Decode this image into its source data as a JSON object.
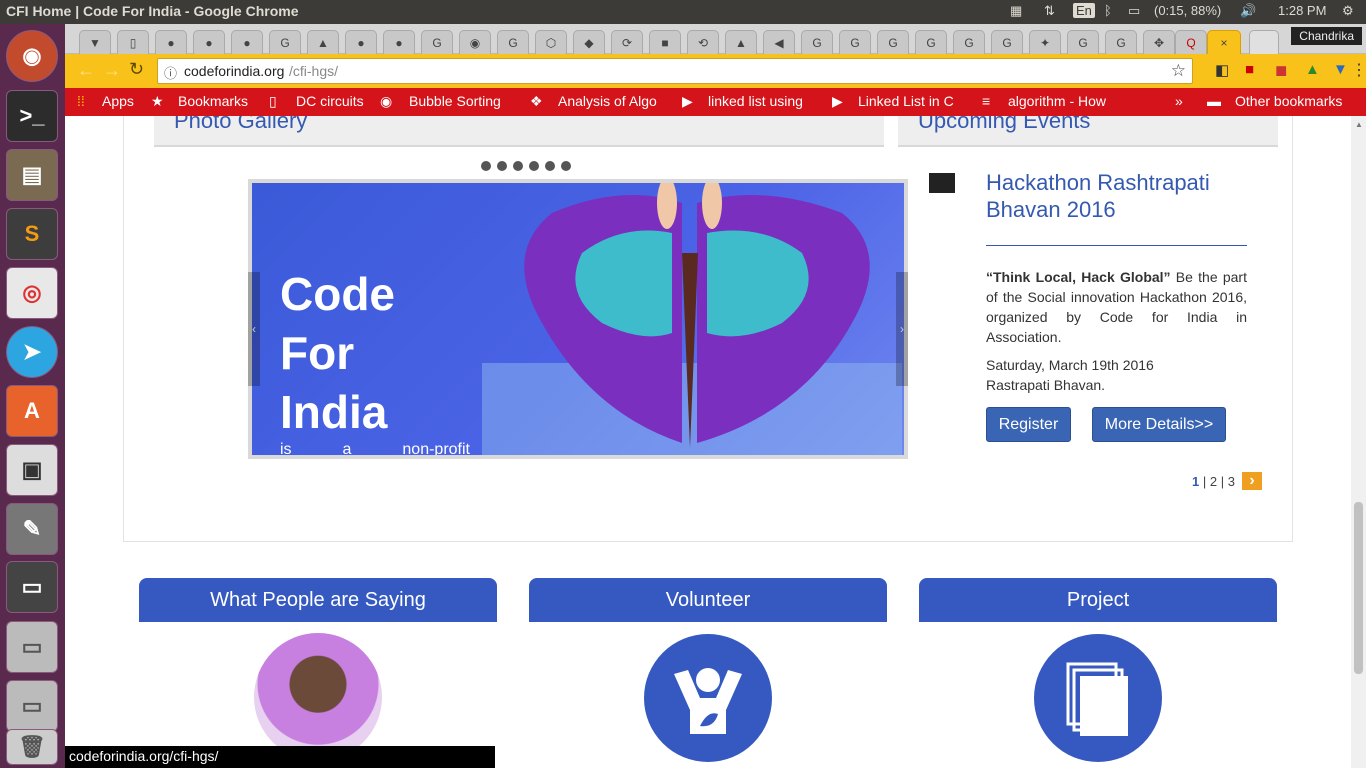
{
  "os": {
    "window_title": "CFI Home | Code For India - Google Chrome",
    "battery": "(0:15, 88%)",
    "time": "1:28 PM",
    "keyboard": "En"
  },
  "launcher": {
    "items": [
      "ubuntu-icon",
      "terminal-icon",
      "files-icon",
      "sublime-icon",
      "chrome-icon",
      "telegram-icon",
      "software-center-icon",
      "camera-icon",
      "settings-icon",
      "disk-icon",
      "drive-icon",
      "drive-icon",
      "trash-icon"
    ]
  },
  "browser": {
    "profile": "Chandrika",
    "url_host": "codeforindia.org",
    "url_path": "/cfi-hgs/",
    "tab_close": "×"
  },
  "bookmarks": [
    "Apps",
    "Bookmarks",
    "DC circuits",
    "Bubble Sorting",
    "Analysis of Algo",
    "linked list using",
    "Linked List in C",
    "algorithm - How"
  ],
  "bookmarks_more": "»",
  "bookmarks_other": "Other bookmarks",
  "gallery": {
    "heading": "Photo Gallery",
    "slide_title": [
      "Code",
      "For",
      "India"
    ],
    "slide_subtitle": [
      "is",
      "a",
      "non-profit"
    ]
  },
  "events": {
    "heading": "Upcoming Events",
    "title": "Hackathon Rashtrapati Bhavan 2016",
    "lead_bold": "“Think Local, Hack Global”",
    "lead_rest": " Be the part of the Social innovation Hackathon 2016, organized by Code for India in Association.",
    "date": "Saturday, March 19th 2016",
    "venue": "Rastrapati Bhavan.",
    "register": "Register",
    "more": "More Details>>",
    "pages": [
      "1",
      "2",
      "3"
    ],
    "separator": "|",
    "next": "›"
  },
  "features": [
    {
      "title": "What People are Saying"
    },
    {
      "title": "Volunteer"
    },
    {
      "title": "Project"
    }
  ],
  "statusbar": "codeforindia.org/cfi-hgs/"
}
